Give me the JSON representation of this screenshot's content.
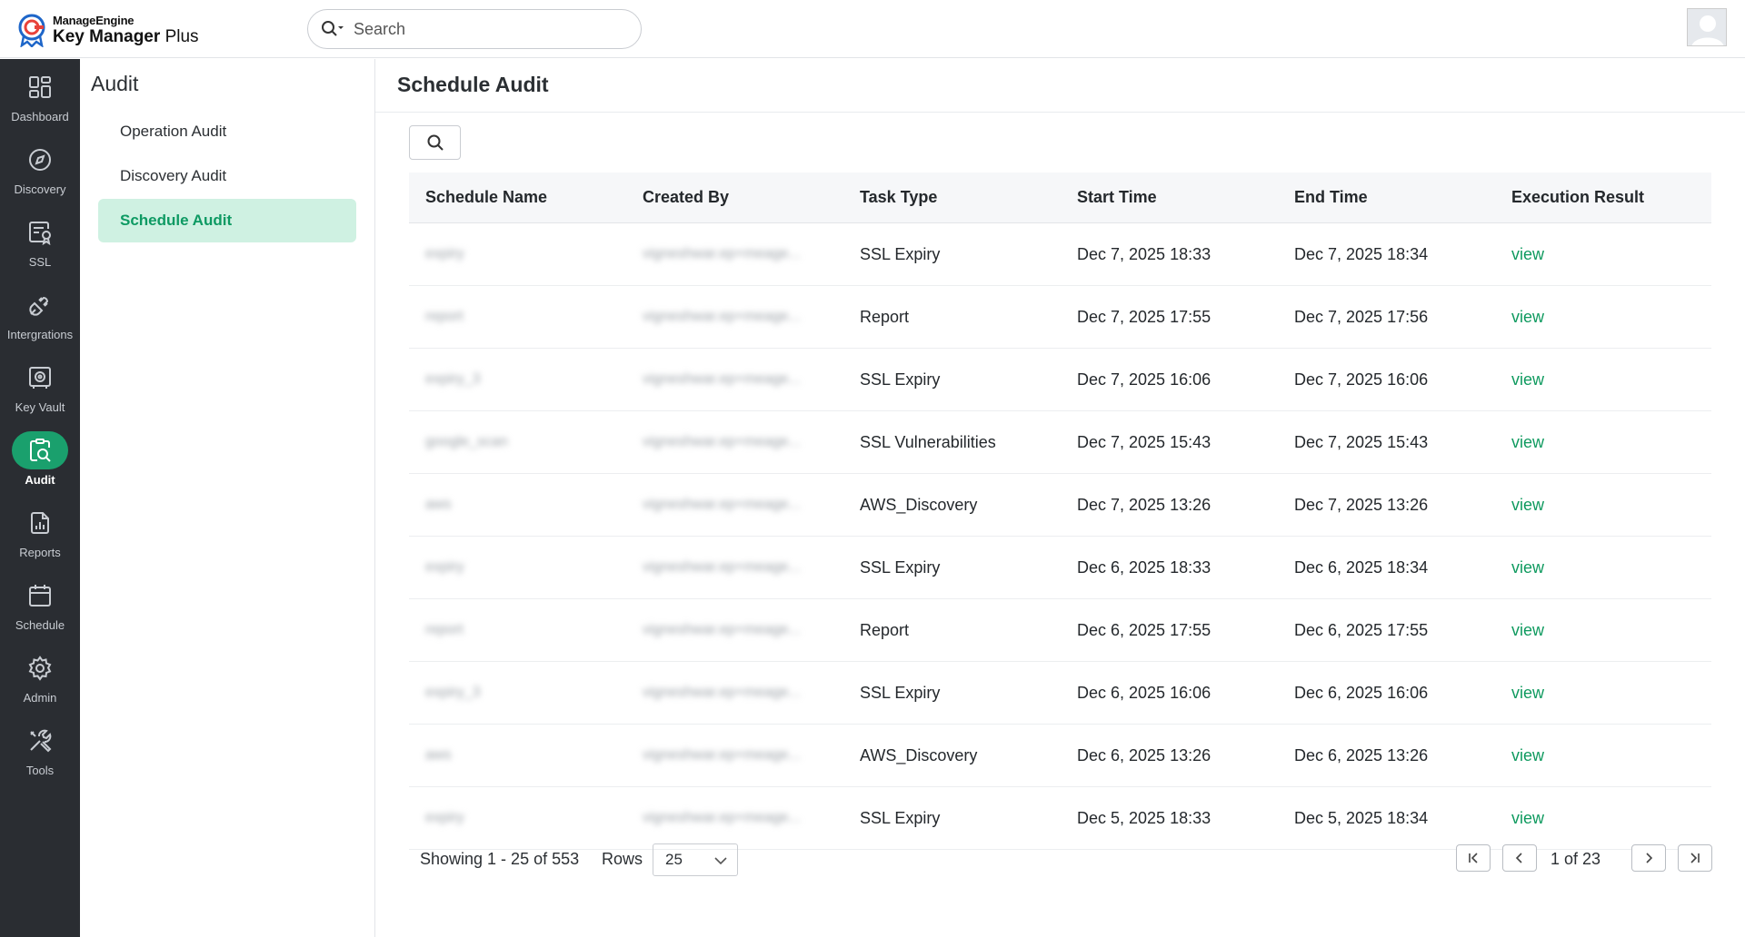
{
  "app": {
    "brand_top": "ManageEngine",
    "brand_name": "Key Manager",
    "brand_suffix": "Plus",
    "accent_color": "#1aa06d"
  },
  "search": {
    "placeholder": "Search"
  },
  "nav": [
    {
      "label": "Dashboard",
      "icon": "dashboard-icon"
    },
    {
      "label": "Discovery",
      "icon": "compass-icon"
    },
    {
      "label": "SSL",
      "icon": "ssl-certificate-icon"
    },
    {
      "label": "Intergrations",
      "icon": "plug-icon"
    },
    {
      "label": "Key Vault",
      "icon": "vault-icon"
    },
    {
      "label": "Audit",
      "icon": "audit-icon",
      "active": true
    },
    {
      "label": "Reports",
      "icon": "report-icon"
    },
    {
      "label": "Schedule",
      "icon": "calendar-icon"
    },
    {
      "label": "Admin",
      "icon": "gear-icon"
    },
    {
      "label": "Tools",
      "icon": "tools-icon"
    }
  ],
  "subnav": {
    "title": "Audit",
    "items": [
      {
        "label": "Operation Audit"
      },
      {
        "label": "Discovery Audit"
      },
      {
        "label": "Schedule Audit",
        "active": true
      }
    ]
  },
  "main": {
    "title": "Schedule Audit",
    "table": {
      "columns": [
        "Schedule Name",
        "Created By",
        "Task Type",
        "Start Time",
        "End Time",
        "Execution Result"
      ],
      "rows": [
        {
          "name": "expiry",
          "created_by": "vigneshwar.ep+meage...",
          "task_type": "SSL Expiry",
          "start": "Dec 7, 2025 18:33",
          "end": "Dec 7, 2025 18:34",
          "result": "view"
        },
        {
          "name": "report",
          "created_by": "vigneshwar.ep+meage...",
          "task_type": "Report",
          "start": "Dec 7, 2025 17:55",
          "end": "Dec 7, 2025 17:56",
          "result": "view"
        },
        {
          "name": "expiry_3",
          "created_by": "vigneshwar.ep+meage...",
          "task_type": "SSL Expiry",
          "start": "Dec 7, 2025 16:06",
          "end": "Dec 7, 2025 16:06",
          "result": "view"
        },
        {
          "name": "google_scan",
          "created_by": "vigneshwar.ep+meage...",
          "task_type": "SSL Vulnerabilities",
          "start": "Dec 7, 2025 15:43",
          "end": "Dec 7, 2025 15:43",
          "result": "view"
        },
        {
          "name": "aws",
          "created_by": "vigneshwar.ep+meage...",
          "task_type": "AWS_Discovery",
          "start": "Dec 7, 2025 13:26",
          "end": "Dec 7, 2025 13:26",
          "result": "view"
        },
        {
          "name": "expiry",
          "created_by": "vigneshwar.ep+meage...",
          "task_type": "SSL Expiry",
          "start": "Dec 6, 2025 18:33",
          "end": "Dec 6, 2025 18:34",
          "result": "view"
        },
        {
          "name": "report",
          "created_by": "vigneshwar.ep+meage...",
          "task_type": "Report",
          "start": "Dec 6, 2025 17:55",
          "end": "Dec 6, 2025 17:55",
          "result": "view"
        },
        {
          "name": "expiry_3",
          "created_by": "vigneshwar.ep+meage...",
          "task_type": "SSL Expiry",
          "start": "Dec 6, 2025 16:06",
          "end": "Dec 6, 2025 16:06",
          "result": "view"
        },
        {
          "name": "aws",
          "created_by": "vigneshwar.ep+meage...",
          "task_type": "AWS_Discovery",
          "start": "Dec 6, 2025 13:26",
          "end": "Dec 6, 2025 13:26",
          "result": "view"
        },
        {
          "name": "expiry",
          "created_by": "vigneshwar.ep+meage...",
          "task_type": "SSL Expiry",
          "start": "Dec 5, 2025 18:33",
          "end": "Dec 5, 2025 18:34",
          "result": "view"
        }
      ]
    },
    "pagination": {
      "showing": "Showing 1 - 25 of 553",
      "rows_label": "Rows",
      "rows_value": "25",
      "page_info": "1 of 23"
    }
  }
}
